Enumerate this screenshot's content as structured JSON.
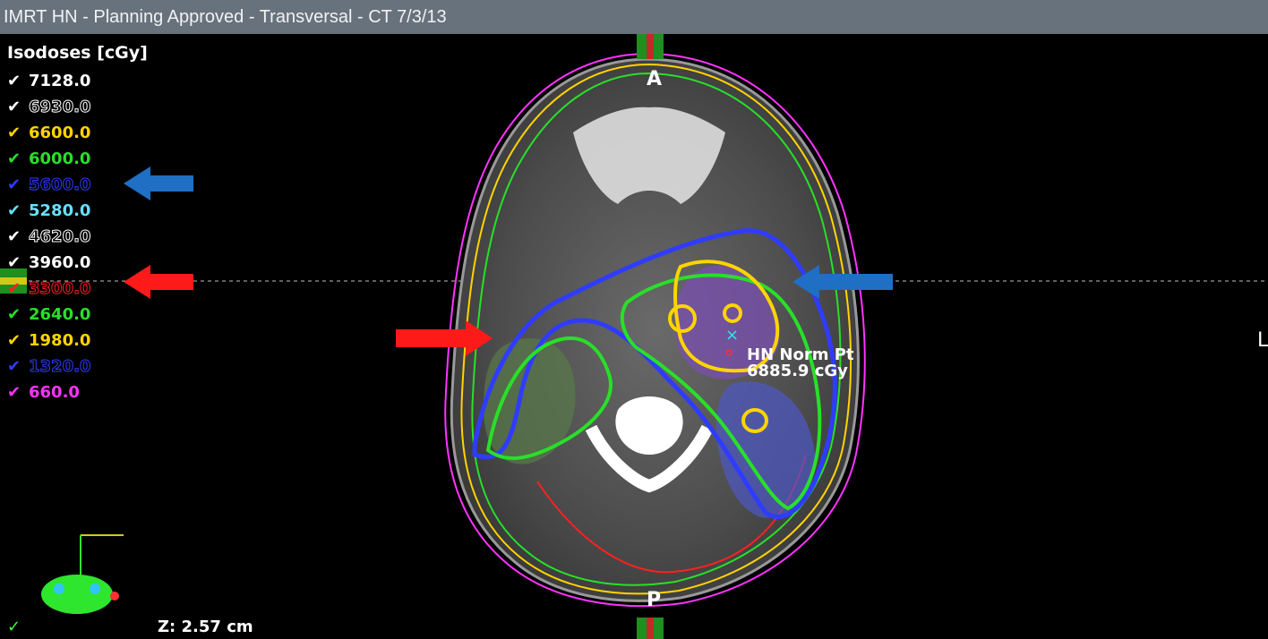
{
  "window": {
    "title": "IMRT HN  -  Planning Approved - Transversal - CT 7/3/13"
  },
  "legend": {
    "title": "Isodoses [cGy]",
    "items": [
      {
        "value": "7128.0",
        "color": "#ffffff",
        "checked": true,
        "outlined": false
      },
      {
        "value": "6930.0",
        "color": "#ffffff",
        "checked": true,
        "outlined": true
      },
      {
        "value": "6600.0",
        "color": "#ffd400",
        "checked": true,
        "outlined": false
      },
      {
        "value": "6000.0",
        "color": "#28e028",
        "checked": true,
        "outlined": false
      },
      {
        "value": "5600.0",
        "color": "#2f3cff",
        "checked": true,
        "outlined": true
      },
      {
        "value": "5280.0",
        "color": "#66e0ff",
        "checked": true,
        "outlined": false
      },
      {
        "value": "4620.0",
        "color": "#ffffff",
        "checked": true,
        "outlined": true
      },
      {
        "value": "3960.0",
        "color": "#ffffff",
        "checked": true,
        "outlined": false
      },
      {
        "value": "3300.0",
        "color": "#ff2020",
        "checked": true,
        "outlined": true
      },
      {
        "value": "2640.0",
        "color": "#28e028",
        "checked": true,
        "outlined": false
      },
      {
        "value": "1980.0",
        "color": "#ffd400",
        "checked": true,
        "outlined": false
      },
      {
        "value": "1320.0",
        "color": "#2f3cff",
        "checked": true,
        "outlined": true
      },
      {
        "value": "660.0",
        "color": "#ff33ff",
        "checked": true,
        "outlined": false
      }
    ]
  },
  "view": {
    "anterior_label": "A",
    "posterior_label": "P",
    "side_label": "L",
    "z_position": "Z: 2.57 cm",
    "norm_point_name": "HN Norm Pt",
    "norm_point_dose": "6885.9 cGy"
  },
  "annotations": {
    "blue_arrow_color": "#1f6fc4",
    "red_arrow_color": "#ff1a1a"
  }
}
